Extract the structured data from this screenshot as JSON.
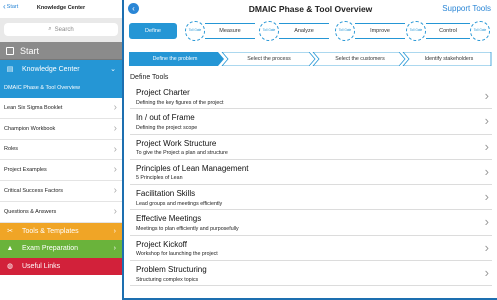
{
  "left": {
    "back_label": "Start",
    "title": "Knowledge Center",
    "search_placeholder": "Search",
    "start_label": "Start",
    "kc_label": "Knowledge Center",
    "items": [
      {
        "label": "DMAIC Phase & Tool Overview"
      },
      {
        "label": "Lean Six Sigma Booklet"
      },
      {
        "label": "Champion Workbook"
      },
      {
        "label": "Roles"
      },
      {
        "label": "Project Examples"
      },
      {
        "label": "Critical Success Factors"
      },
      {
        "label": "Questions & Answers"
      }
    ],
    "tools_label": "Tools & Templates",
    "exam_label": "Exam Preparation",
    "links_label": "Useful Links"
  },
  "right": {
    "title": "DMAIC Phase & Tool Overview",
    "support_label": "Support Tools",
    "phases": [
      "Define",
      "Measure",
      "Analyze",
      "Improve",
      "Control"
    ],
    "gate_label": "Toll Gate",
    "steps": [
      "Define the problem",
      "Select the process",
      "Select the customers",
      "Identify stakeholders"
    ],
    "section_title": "Define Tools",
    "tools": [
      {
        "title": "Project Charter",
        "subtitle": "Defining the key figures of the project"
      },
      {
        "title": "In / out of Frame",
        "subtitle": "Defining the project scope"
      },
      {
        "title": "Project Work Structure",
        "subtitle": "To give the Project a plan and structure"
      },
      {
        "title": "Principles of Lean Management",
        "subtitle": "5 Principles of Lean"
      },
      {
        "title": "Facilitation Skills",
        "subtitle": "Lead groups and meetings efficiently"
      },
      {
        "title": "Effective Meetings",
        "subtitle": "Meetings to plan efficiently and purposefully"
      },
      {
        "title": "Project Kickoff",
        "subtitle": "Workshop for launching the project"
      },
      {
        "title": "Problem Structuring",
        "subtitle": "Structuring complex topics"
      }
    ]
  },
  "colors": {
    "accent": "#2596d5",
    "tools": "#f0a526",
    "exam": "#6ab33b",
    "links": "#d2213a",
    "start": "#8b8b8b"
  }
}
